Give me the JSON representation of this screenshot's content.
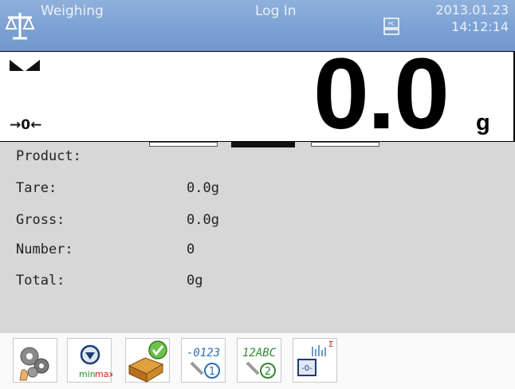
{
  "header": {
    "title": "Weighing",
    "login": "Log In",
    "date": "2013.01.23",
    "time": "14:12:14",
    "background": "#7aa0d3"
  },
  "display": {
    "weight": "0.0",
    "unit": "g",
    "zero_indicator": "→0←"
  },
  "info": {
    "rows": [
      {
        "label": "Product:",
        "value": ""
      },
      {
        "label": "Tare:",
        "value": "0.0g"
      },
      {
        "label": "Gross:",
        "value": "0.0g"
      },
      {
        "label": "Number:",
        "value": "0"
      },
      {
        "label": "Total:",
        "value": "0g"
      }
    ]
  },
  "toolbar": {
    "minmax_label_min": "min",
    "minmax_label_max": "max",
    "numeric_btn_text": "-0123",
    "numeric_btn_badge": "1",
    "alpha_btn_text": "12ABC",
    "alpha_btn_badge": "2",
    "sum_btn_text": "-0-",
    "sum_btn_sigma": "Σ",
    "icons": [
      "settings-gears-icon",
      "min-max-icon",
      "product-database-icon",
      "numeric-input-icon",
      "alphanumeric-input-icon",
      "zero-sum-icon"
    ]
  }
}
